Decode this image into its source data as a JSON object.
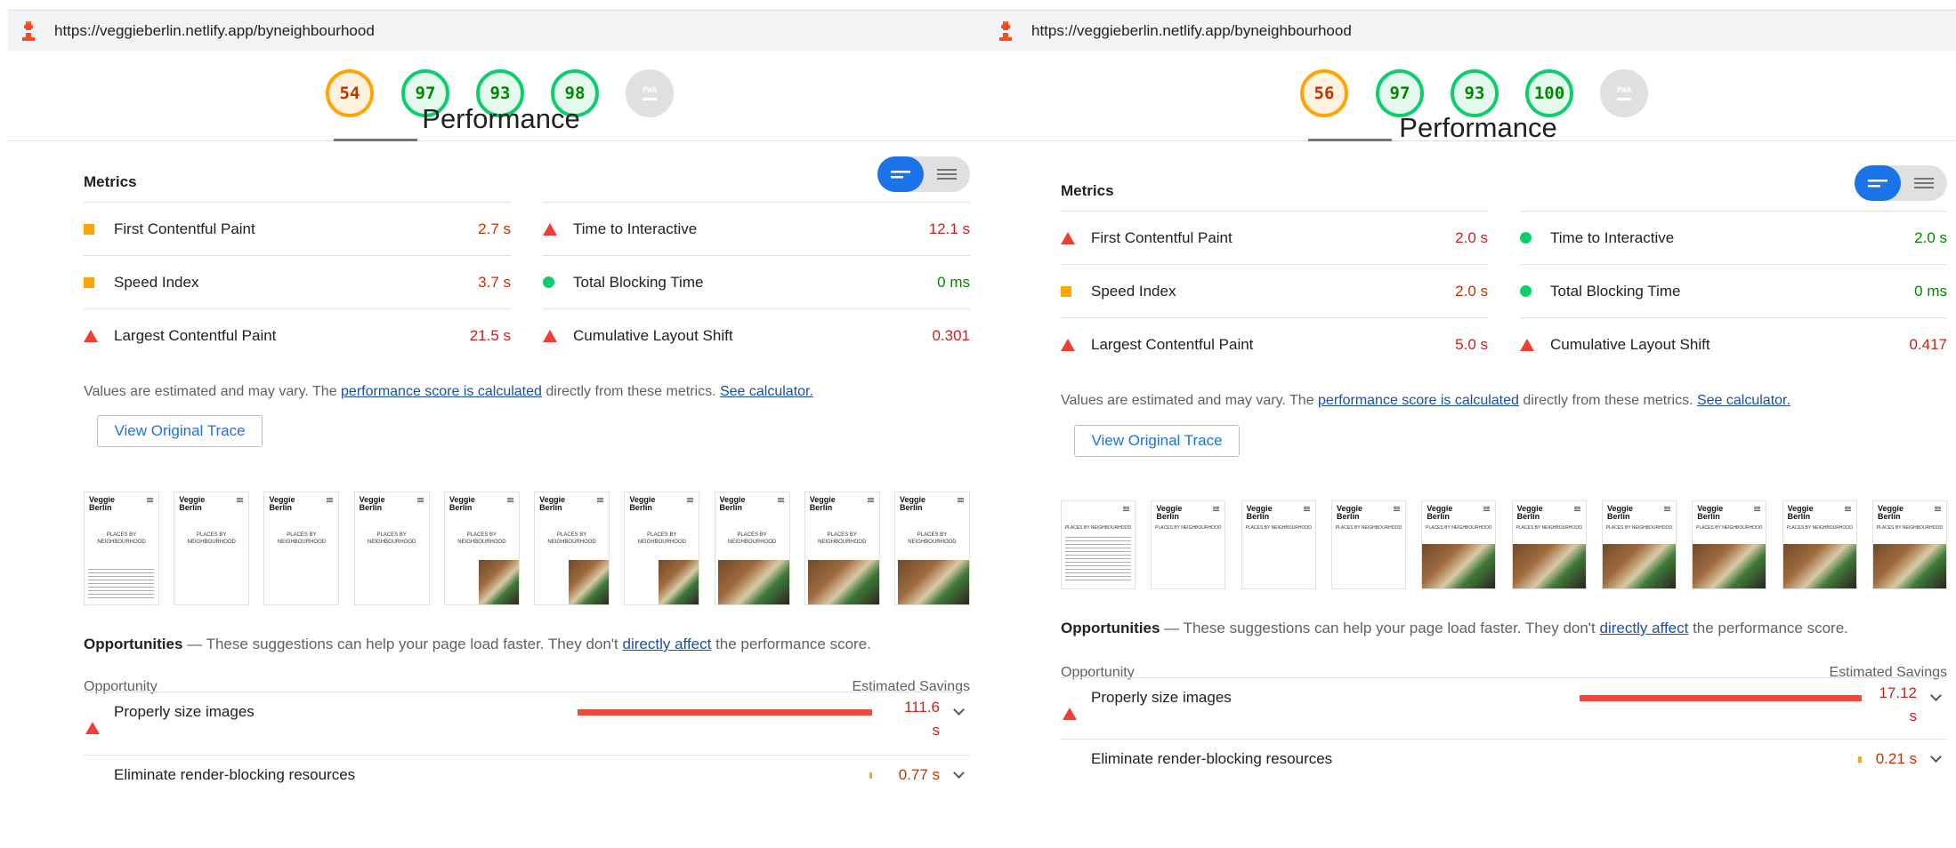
{
  "panels": [
    {
      "url": "https://veggieberlin.netlify.app/byneighbourhood",
      "scores": [
        "54",
        "97",
        "93",
        "98"
      ],
      "pwa_label": "PWA",
      "title": "Performance",
      "metrics_label": "Metrics",
      "metrics": [
        {
          "label": "First Contentful Paint",
          "value": "2.7 s",
          "status": "average",
          "icon": "square-icon"
        },
        {
          "label": "Time to Interactive",
          "value": "12.1 s",
          "status": "fail",
          "icon": "triangle-icon"
        },
        {
          "label": "Speed Index",
          "value": "3.7 s",
          "status": "average",
          "icon": "square-icon"
        },
        {
          "label": "Total Blocking Time",
          "value": "0 ms",
          "status": "pass",
          "icon": "circle-icon"
        },
        {
          "label": "Largest Contentful Paint",
          "value": "21.5 s",
          "status": "fail",
          "icon": "triangle-icon"
        },
        {
          "label": "Cumulative Layout Shift",
          "value": "0.301",
          "status": "fail",
          "icon": "triangle-icon"
        }
      ],
      "note_prefix": "Values are estimated and may vary. The ",
      "note_link1": "performance score is calculated",
      "note_middle": " directly from these metrics. ",
      "note_link2": "See calculator.",
      "trace_button": "View Original Trace",
      "frames": [
        {
          "brand": "Veggie Berlin",
          "places": "PLACES BY NEIGHBOURHOOD",
          "image": false,
          "text": true
        },
        {
          "brand": "Veggie Berlin",
          "places": "PLACES BY NEIGHBOURHOOD",
          "image": false,
          "text": false
        },
        {
          "brand": "Veggie Berlin",
          "places": "PLACES BY NEIGHBOURHOOD",
          "image": false,
          "text": false
        },
        {
          "brand": "Veggie Berlin",
          "places": "PLACES BY NEIGHBOURHOOD",
          "image": false,
          "text": false
        },
        {
          "brand": "Veggie Berlin",
          "places": "PLACES BY NEIGHBOURHOOD",
          "image": true,
          "text": false
        },
        {
          "brand": "Veggie Berlin",
          "places": "PLACES BY NEIGHBOURHOOD",
          "image": true,
          "text": false
        },
        {
          "brand": "Veggie Berlin",
          "places": "PLACES BY NEIGHBOURHOOD",
          "image": true,
          "text": false
        },
        {
          "brand": "Veggie Berlin",
          "places": "PLACES BY NEIGHBOURHOOD",
          "image": true,
          "text": false
        },
        {
          "brand": "Veggie Berlin",
          "places": "PLACES BY NEIGHBOURHOOD",
          "image": true,
          "text": false
        },
        {
          "brand": "Veggie Berlin",
          "places": "PLACES BY NEIGHBOURHOOD",
          "image": true,
          "text": false
        }
      ],
      "opp_title": "Opportunities",
      "opp_dash": " — These suggestions can help your page load faster. They don't ",
      "opp_link": "directly affect",
      "opp_tail": " the performance score.",
      "opp_col1": "Opportunity",
      "opp_col2": "Estimated Savings",
      "opportunities": [
        {
          "label": "Properly size images",
          "savings": "111.6 s",
          "savings_fraction": 1.0,
          "status": "fail"
        },
        {
          "label": "Eliminate render-blocking resources",
          "savings": "0.77 s",
          "savings_fraction": 0.007,
          "status": "average"
        }
      ]
    },
    {
      "url": "https://veggieberlin.netlify.app/byneighbourhood",
      "scores": [
        "56",
        "97",
        "93",
        "100"
      ],
      "pwa_label": "PWA",
      "title": "Performance",
      "metrics_label": "Metrics",
      "metrics": [
        {
          "label": "First Contentful Paint",
          "value": "2.0 s",
          "status": "fail",
          "icon": "triangle-icon"
        },
        {
          "label": "Time to Interactive",
          "value": "2.0 s",
          "status": "pass",
          "icon": "circle-icon"
        },
        {
          "label": "Speed Index",
          "value": "2.0 s",
          "status": "average",
          "icon": "square-icon"
        },
        {
          "label": "Total Blocking Time",
          "value": "0 ms",
          "status": "pass",
          "icon": "circle-icon"
        },
        {
          "label": "Largest Contentful Paint",
          "value": "5.0 s",
          "status": "fail",
          "icon": "triangle-icon"
        },
        {
          "label": "Cumulative Layout Shift",
          "value": "0.417",
          "status": "fail",
          "icon": "triangle-icon"
        }
      ],
      "note_prefix": "Values are estimated and may vary. The ",
      "note_link1": "performance score is calculated",
      "note_middle": " directly from these metrics. ",
      "note_link2": "See calculator.",
      "trace_button": "View Original Trace",
      "frames": [
        {
          "brand": "",
          "places": "PLACES BY NEIGHBOURHOOD",
          "image": false,
          "text": true
        },
        {
          "brand": "Veggie Berlin",
          "places": "PLACES BY NEIGHBOURHOOD",
          "image": false,
          "text": false
        },
        {
          "brand": "Veggie Berlin",
          "places": "PLACES BY NEIGHBOURHOOD",
          "image": false,
          "text": false
        },
        {
          "brand": "Veggie Berlin",
          "places": "PLACES BY NEIGHBOURHOOD",
          "image": false,
          "text": false
        },
        {
          "brand": "Veggie Berlin",
          "places": "PLACES BY NEIGHBOURHOOD",
          "image": true,
          "text": false
        },
        {
          "brand": "Veggie Berlin",
          "places": "PLACES BY NEIGHBOURHOOD",
          "image": true,
          "text": false
        },
        {
          "brand": "Veggie Berlin",
          "places": "PLACES BY NEIGHBOURHOOD",
          "image": true,
          "text": false
        },
        {
          "brand": "Veggie Berlin",
          "places": "PLACES BY NEIGHBOURHOOD",
          "image": true,
          "text": false
        },
        {
          "brand": "Veggie Berlin",
          "places": "PLACES BY NEIGHBOURHOOD",
          "image": true,
          "text": false
        },
        {
          "brand": "Veggie Berlin",
          "places": "PLACES BY NEIGHBOURHOOD",
          "image": true,
          "text": false
        }
      ],
      "opp_title": "Opportunities",
      "opp_dash": " — These suggestions can help your page load faster. They don't ",
      "opp_link": "directly affect",
      "opp_tail": " the performance score.",
      "opp_col1": "Opportunity",
      "opp_col2": "Estimated Savings",
      "opportunities": [
        {
          "label": "Properly size images",
          "savings": "17.12 s",
          "savings_fraction": 1.0,
          "status": "fail"
        },
        {
          "label": "Eliminate render-blocking resources",
          "savings": "0.21 s",
          "savings_fraction": 0.012,
          "status": "average"
        }
      ]
    }
  ],
  "colors": {
    "fail": "#eb0f00",
    "average": "#ffa400",
    "pass": "#0cce6b",
    "link": "#1a4ea8",
    "accent": "#1a73e8"
  }
}
